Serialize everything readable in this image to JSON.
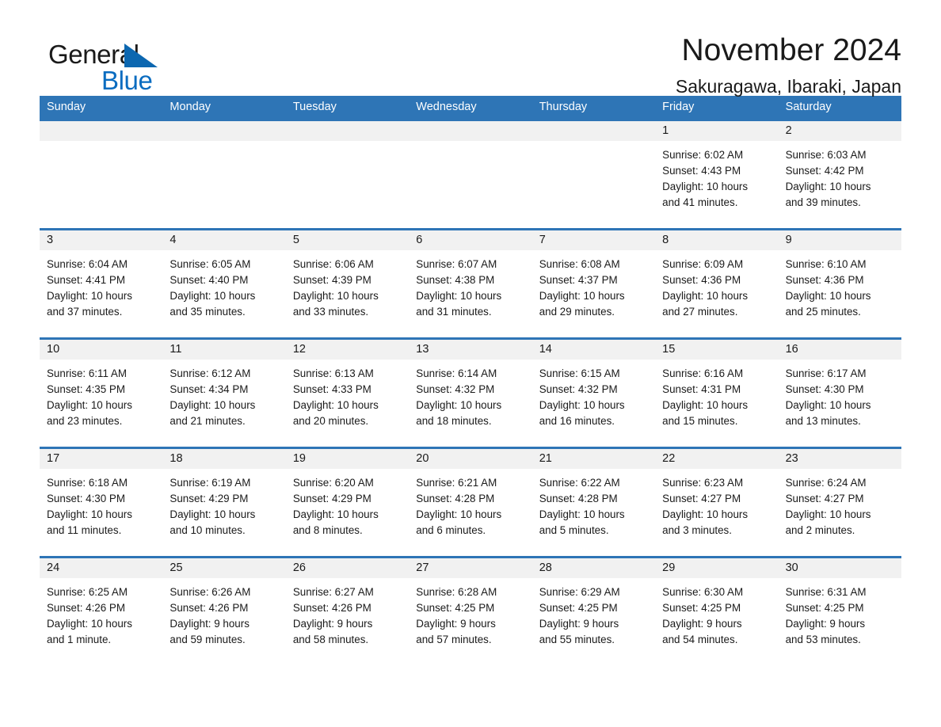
{
  "brand": {
    "name_part1": "General",
    "name_part2": "Blue",
    "triangle_color": "#0c67b0",
    "blue_color": "#0a6cc0"
  },
  "header": {
    "title": "November 2024",
    "subtitle": "Sakuragawa, Ibaraki, Japan"
  },
  "theme": {
    "header_blue": "#2e75b6",
    "daynum_band": "#f1f1f1",
    "text": "#1a1a1a"
  },
  "weekdays": [
    "Sunday",
    "Monday",
    "Tuesday",
    "Wednesday",
    "Thursday",
    "Friday",
    "Saturday"
  ],
  "weeks": [
    [
      {
        "day": "",
        "sunrise": "",
        "sunset": "",
        "daylight_line1": "",
        "daylight_line2": ""
      },
      {
        "day": "",
        "sunrise": "",
        "sunset": "",
        "daylight_line1": "",
        "daylight_line2": ""
      },
      {
        "day": "",
        "sunrise": "",
        "sunset": "",
        "daylight_line1": "",
        "daylight_line2": ""
      },
      {
        "day": "",
        "sunrise": "",
        "sunset": "",
        "daylight_line1": "",
        "daylight_line2": ""
      },
      {
        "day": "",
        "sunrise": "",
        "sunset": "",
        "daylight_line1": "",
        "daylight_line2": ""
      },
      {
        "day": "1",
        "sunrise": "Sunrise: 6:02 AM",
        "sunset": "Sunset: 4:43 PM",
        "daylight_line1": "Daylight: 10 hours",
        "daylight_line2": "and 41 minutes."
      },
      {
        "day": "2",
        "sunrise": "Sunrise: 6:03 AM",
        "sunset": "Sunset: 4:42 PM",
        "daylight_line1": "Daylight: 10 hours",
        "daylight_line2": "and 39 minutes."
      }
    ],
    [
      {
        "day": "3",
        "sunrise": "Sunrise: 6:04 AM",
        "sunset": "Sunset: 4:41 PM",
        "daylight_line1": "Daylight: 10 hours",
        "daylight_line2": "and 37 minutes."
      },
      {
        "day": "4",
        "sunrise": "Sunrise: 6:05 AM",
        "sunset": "Sunset: 4:40 PM",
        "daylight_line1": "Daylight: 10 hours",
        "daylight_line2": "and 35 minutes."
      },
      {
        "day": "5",
        "sunrise": "Sunrise: 6:06 AM",
        "sunset": "Sunset: 4:39 PM",
        "daylight_line1": "Daylight: 10 hours",
        "daylight_line2": "and 33 minutes."
      },
      {
        "day": "6",
        "sunrise": "Sunrise: 6:07 AM",
        "sunset": "Sunset: 4:38 PM",
        "daylight_line1": "Daylight: 10 hours",
        "daylight_line2": "and 31 minutes."
      },
      {
        "day": "7",
        "sunrise": "Sunrise: 6:08 AM",
        "sunset": "Sunset: 4:37 PM",
        "daylight_line1": "Daylight: 10 hours",
        "daylight_line2": "and 29 minutes."
      },
      {
        "day": "8",
        "sunrise": "Sunrise: 6:09 AM",
        "sunset": "Sunset: 4:36 PM",
        "daylight_line1": "Daylight: 10 hours",
        "daylight_line2": "and 27 minutes."
      },
      {
        "day": "9",
        "sunrise": "Sunrise: 6:10 AM",
        "sunset": "Sunset: 4:36 PM",
        "daylight_line1": "Daylight: 10 hours",
        "daylight_line2": "and 25 minutes."
      }
    ],
    [
      {
        "day": "10",
        "sunrise": "Sunrise: 6:11 AM",
        "sunset": "Sunset: 4:35 PM",
        "daylight_line1": "Daylight: 10 hours",
        "daylight_line2": "and 23 minutes."
      },
      {
        "day": "11",
        "sunrise": "Sunrise: 6:12 AM",
        "sunset": "Sunset: 4:34 PM",
        "daylight_line1": "Daylight: 10 hours",
        "daylight_line2": "and 21 minutes."
      },
      {
        "day": "12",
        "sunrise": "Sunrise: 6:13 AM",
        "sunset": "Sunset: 4:33 PM",
        "daylight_line1": "Daylight: 10 hours",
        "daylight_line2": "and 20 minutes."
      },
      {
        "day": "13",
        "sunrise": "Sunrise: 6:14 AM",
        "sunset": "Sunset: 4:32 PM",
        "daylight_line1": "Daylight: 10 hours",
        "daylight_line2": "and 18 minutes."
      },
      {
        "day": "14",
        "sunrise": "Sunrise: 6:15 AM",
        "sunset": "Sunset: 4:32 PM",
        "daylight_line1": "Daylight: 10 hours",
        "daylight_line2": "and 16 minutes."
      },
      {
        "day": "15",
        "sunrise": "Sunrise: 6:16 AM",
        "sunset": "Sunset: 4:31 PM",
        "daylight_line1": "Daylight: 10 hours",
        "daylight_line2": "and 15 minutes."
      },
      {
        "day": "16",
        "sunrise": "Sunrise: 6:17 AM",
        "sunset": "Sunset: 4:30 PM",
        "daylight_line1": "Daylight: 10 hours",
        "daylight_line2": "and 13 minutes."
      }
    ],
    [
      {
        "day": "17",
        "sunrise": "Sunrise: 6:18 AM",
        "sunset": "Sunset: 4:30 PM",
        "daylight_line1": "Daylight: 10 hours",
        "daylight_line2": "and 11 minutes."
      },
      {
        "day": "18",
        "sunrise": "Sunrise: 6:19 AM",
        "sunset": "Sunset: 4:29 PM",
        "daylight_line1": "Daylight: 10 hours",
        "daylight_line2": "and 10 minutes."
      },
      {
        "day": "19",
        "sunrise": "Sunrise: 6:20 AM",
        "sunset": "Sunset: 4:29 PM",
        "daylight_line1": "Daylight: 10 hours",
        "daylight_line2": "and 8 minutes."
      },
      {
        "day": "20",
        "sunrise": "Sunrise: 6:21 AM",
        "sunset": "Sunset: 4:28 PM",
        "daylight_line1": "Daylight: 10 hours",
        "daylight_line2": "and 6 minutes."
      },
      {
        "day": "21",
        "sunrise": "Sunrise: 6:22 AM",
        "sunset": "Sunset: 4:28 PM",
        "daylight_line1": "Daylight: 10 hours",
        "daylight_line2": "and 5 minutes."
      },
      {
        "day": "22",
        "sunrise": "Sunrise: 6:23 AM",
        "sunset": "Sunset: 4:27 PM",
        "daylight_line1": "Daylight: 10 hours",
        "daylight_line2": "and 3 minutes."
      },
      {
        "day": "23",
        "sunrise": "Sunrise: 6:24 AM",
        "sunset": "Sunset: 4:27 PM",
        "daylight_line1": "Daylight: 10 hours",
        "daylight_line2": "and 2 minutes."
      }
    ],
    [
      {
        "day": "24",
        "sunrise": "Sunrise: 6:25 AM",
        "sunset": "Sunset: 4:26 PM",
        "daylight_line1": "Daylight: 10 hours",
        "daylight_line2": "and 1 minute."
      },
      {
        "day": "25",
        "sunrise": "Sunrise: 6:26 AM",
        "sunset": "Sunset: 4:26 PM",
        "daylight_line1": "Daylight: 9 hours",
        "daylight_line2": "and 59 minutes."
      },
      {
        "day": "26",
        "sunrise": "Sunrise: 6:27 AM",
        "sunset": "Sunset: 4:26 PM",
        "daylight_line1": "Daylight: 9 hours",
        "daylight_line2": "and 58 minutes."
      },
      {
        "day": "27",
        "sunrise": "Sunrise: 6:28 AM",
        "sunset": "Sunset: 4:25 PM",
        "daylight_line1": "Daylight: 9 hours",
        "daylight_line2": "and 57 minutes."
      },
      {
        "day": "28",
        "sunrise": "Sunrise: 6:29 AM",
        "sunset": "Sunset: 4:25 PM",
        "daylight_line1": "Daylight: 9 hours",
        "daylight_line2": "and 55 minutes."
      },
      {
        "day": "29",
        "sunrise": "Sunrise: 6:30 AM",
        "sunset": "Sunset: 4:25 PM",
        "daylight_line1": "Daylight: 9 hours",
        "daylight_line2": "and 54 minutes."
      },
      {
        "day": "30",
        "sunrise": "Sunrise: 6:31 AM",
        "sunset": "Sunset: 4:25 PM",
        "daylight_line1": "Daylight: 9 hours",
        "daylight_line2": "and 53 minutes."
      }
    ]
  ]
}
